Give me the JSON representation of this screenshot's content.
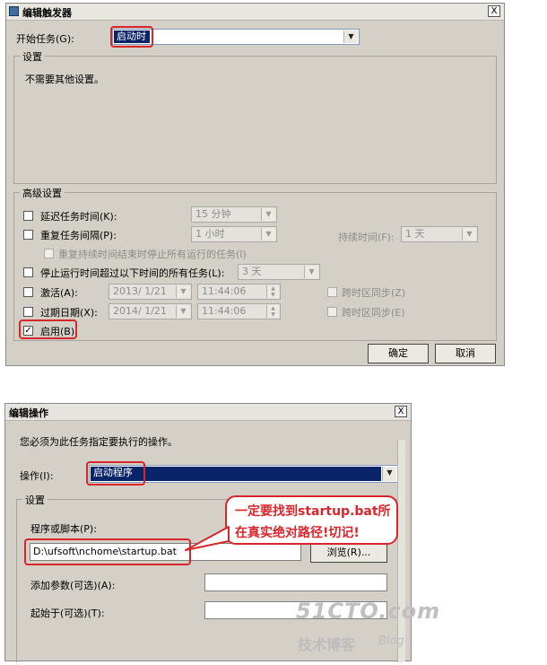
{
  "trigger_dialog": {
    "title": "编辑触发器",
    "close_glyph": "X",
    "begin_task_label": "开始任务(G):",
    "begin_task_value": "启动时",
    "settings_group_label": "设置",
    "settings_text": "不需要其他设置。",
    "advanced_group_label": "高级设置",
    "delay_label": "延迟任务时间(K):",
    "delay_value": "15 分钟",
    "repeat_label": "重复任务间隔(P):",
    "repeat_value": "1 小时",
    "duration_label": "持续时间(F):",
    "duration_value": "1 天",
    "stop_repeat_label": "重复持续时间结束时停止所有运行的任务(I)",
    "stop_long_label": "停止运行时间超过以下时间的所有任务(L):",
    "stop_long_value": "3 天",
    "activate_label": "激活(A):",
    "activate_date": "2013/ 1/21",
    "activate_time": "11:44:06",
    "activate_sync_label": "跨时区同步(Z)",
    "expire_label": "过期日期(X):",
    "expire_date": "2014/ 1/21",
    "expire_time": "11:44:06",
    "expire_sync_label": "跨时区同步(E)",
    "enabled_label": "启用(B)",
    "enabled_check": "✓",
    "ok_label": "确定",
    "cancel_label": "取消"
  },
  "action_dialog": {
    "title": "编辑操作",
    "close_glyph": "X",
    "instruction": "您必须为此任务指定要执行的操作。",
    "action_label": "操作(I):",
    "action_value": "启动程序",
    "settings_group_label": "设置",
    "program_label": "程序或脚本(P):",
    "program_value": "D:\\ufsoft\\nchome\\startup.bat",
    "browse_label": "浏览(R)...",
    "args_label": "添加参数(可选)(A):",
    "start_in_label": "起始于(可选)(T):"
  },
  "callout": {
    "line1": "一定要找到startup.bat所",
    "line2": "在真实绝对路径!切记!"
  },
  "watermark": {
    "site": "51CTO.com",
    "tagline": "技术博客",
    "blog": "Blog"
  },
  "colors": {
    "highlight_red": "#d8262b",
    "selection_blue": "#0a246a",
    "dialog_gray": "#d4d0c8"
  }
}
